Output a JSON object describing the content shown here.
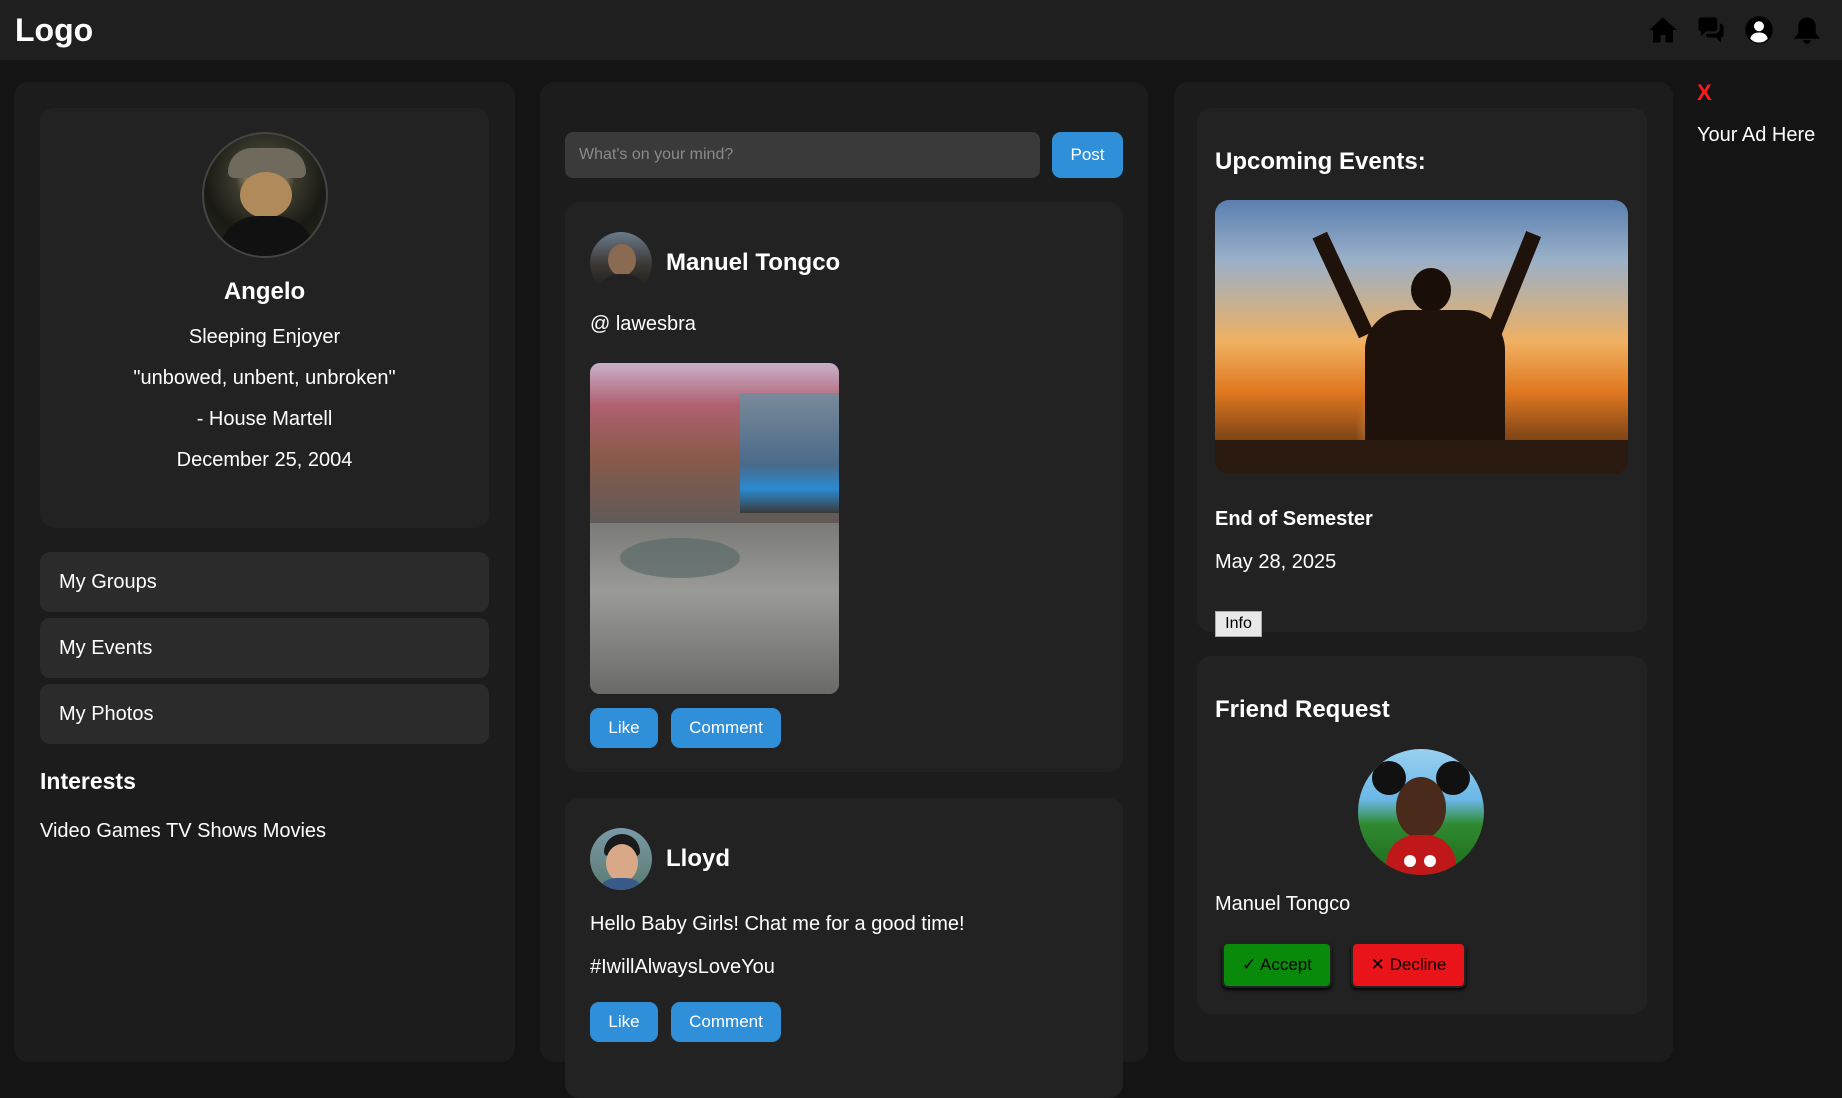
{
  "header": {
    "logo": "Logo",
    "icons": [
      "home-icon",
      "chat-icon",
      "profile-icon",
      "bell-icon"
    ]
  },
  "profile": {
    "name": "Angelo",
    "bio": "Sleeping Enjoyer",
    "quote": "\"unbowed, unbent, unbroken\"",
    "quote_source": "- House Martell",
    "birthday": "December 25, 2004"
  },
  "menu": {
    "items": [
      "My Groups",
      "My Events",
      "My Photos"
    ]
  },
  "interests": {
    "title": "Interests",
    "list": "Video Games TV Shows Movies"
  },
  "composer": {
    "placeholder": "What's on your mind?",
    "post_label": "Post"
  },
  "posts": [
    {
      "author": "Manuel Tongco",
      "text": "@ lawesbra",
      "like_label": "Like",
      "comment_label": "Comment"
    },
    {
      "author": "Lloyd",
      "text": "Hello Baby Girls! Chat me for a good time!",
      "text2": "#IwillAlwaysLoveYou",
      "like_label": "Like",
      "comment_label": "Comment"
    }
  ],
  "events": {
    "title": "Upcoming Events:",
    "name": "End of Semester",
    "date": "May 28, 2025",
    "info_label": "Info"
  },
  "friend_request": {
    "title": "Friend Request",
    "name": "Manuel Tongco",
    "accept_label": "✓ Accept",
    "decline_label": "✕ Decline"
  },
  "ad": {
    "close_label": "X",
    "text": "Your Ad Here"
  },
  "colors": {
    "accent": "#2f8fd8",
    "accept": "#0a8a0a",
    "decline": "#e8141a",
    "ad_close": "#ff1a1a"
  }
}
